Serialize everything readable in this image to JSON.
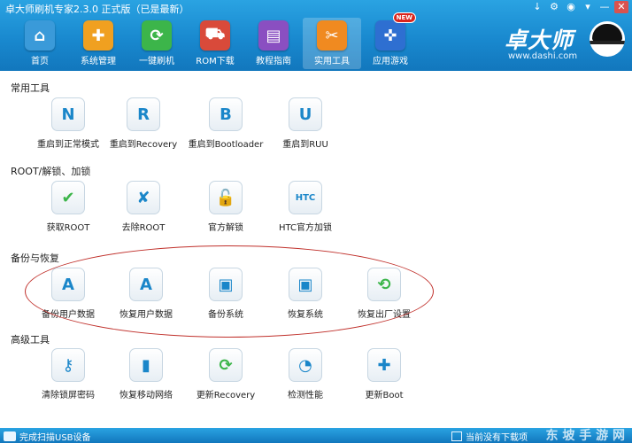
{
  "window": {
    "title": "卓大师刷机专家2.3.0 正式版（已是最新）",
    "controls": [
      "↓",
      "⚙",
      "◉",
      "▾",
      "—",
      "✕"
    ]
  },
  "nav": [
    {
      "label": "首页",
      "icon": "home-icon",
      "color": "#3a9ad9"
    },
    {
      "label": "系统管理",
      "icon": "medkit-icon",
      "color": "#f0a020"
    },
    {
      "label": "一键刷机",
      "icon": "refresh-icon",
      "color": "#3cb54a"
    },
    {
      "label": "ROM下载",
      "icon": "cart-icon",
      "color": "#d94a3a"
    },
    {
      "label": "教程指南",
      "icon": "book-icon",
      "color": "#8a4fc1"
    },
    {
      "label": "实用工具",
      "icon": "tools-icon",
      "color": "#f08a20"
    },
    {
      "label": "应用游戏",
      "icon": "gamepad-icon",
      "color": "#2e6fd1",
      "badge": "NEW"
    }
  ],
  "brand": {
    "name": "卓大师",
    "url": "www.dashi.com"
  },
  "sections": [
    {
      "title": "常用工具",
      "tools": [
        {
          "label": "重启到正常模式",
          "glyph": "N"
        },
        {
          "label": "重启到Recovery",
          "glyph": "R"
        },
        {
          "label": "重启到Bootloader",
          "glyph": "B"
        },
        {
          "label": "重启到RUU",
          "glyph": "U"
        }
      ]
    },
    {
      "title": "ROOT/解锁、加锁",
      "tools": [
        {
          "label": "获取ROOT",
          "glyph": "✔"
        },
        {
          "label": "去除ROOT",
          "glyph": "✘"
        },
        {
          "label": "官方解锁",
          "glyph": "🔓"
        },
        {
          "label": "HTC官方加锁",
          "glyph": "HTC"
        }
      ]
    },
    {
      "title": "备份与恢复",
      "tools": [
        {
          "label": "备份用户数据",
          "glyph": "A"
        },
        {
          "label": "恢复用户数据",
          "glyph": "A"
        },
        {
          "label": "备份系统",
          "glyph": "▣"
        },
        {
          "label": "恢复系统",
          "glyph": "▣"
        },
        {
          "label": "恢复出厂设置",
          "glyph": "⟲"
        }
      ]
    },
    {
      "title": "高级工具",
      "tools": [
        {
          "label": "清除锁屏密码",
          "glyph": "⚷"
        },
        {
          "label": "恢复移动网络",
          "glyph": "▮"
        },
        {
          "label": "更新Recovery",
          "glyph": "⟳"
        },
        {
          "label": "检测性能",
          "glyph": "◔"
        },
        {
          "label": "更新Boot",
          "glyph": "✚"
        }
      ]
    }
  ],
  "status": {
    "left_text": "完成扫描USB设备",
    "right_text": "当前没有下载项",
    "watermark": "东 坡 手 游 网"
  }
}
